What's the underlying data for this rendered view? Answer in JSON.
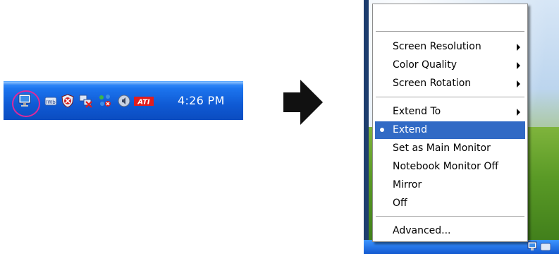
{
  "taskbar": {
    "clock": "4:26 PM",
    "icons": [
      {
        "name": "display-icon"
      },
      {
        "name": "iwb-icon",
        "text": "IWb"
      },
      {
        "name": "security-shield-icon"
      },
      {
        "name": "network-error-icon"
      },
      {
        "name": "network-status-icon"
      },
      {
        "name": "speaker-icon"
      },
      {
        "name": "ati-icon",
        "text": "ATI"
      }
    ]
  },
  "menu": {
    "items": [
      {
        "label": "Screen Resolution",
        "submenu": true
      },
      {
        "label": "Color Quality",
        "submenu": true
      },
      {
        "label": "Screen Rotation",
        "submenu": true
      },
      {
        "label": "Extend To",
        "submenu": true
      },
      {
        "label": "Extend",
        "selected": true
      },
      {
        "label": "Set as Main Monitor"
      },
      {
        "label": "Notebook Monitor Off"
      },
      {
        "label": "Mirror"
      },
      {
        "label": "Off"
      },
      {
        "label": "Advanced..."
      }
    ]
  },
  "colors": {
    "taskbar_blue": "#0f5ad4",
    "menu_highlight": "#316ac5",
    "ring": "#e0289a",
    "ati_red": "#e21d1d"
  }
}
